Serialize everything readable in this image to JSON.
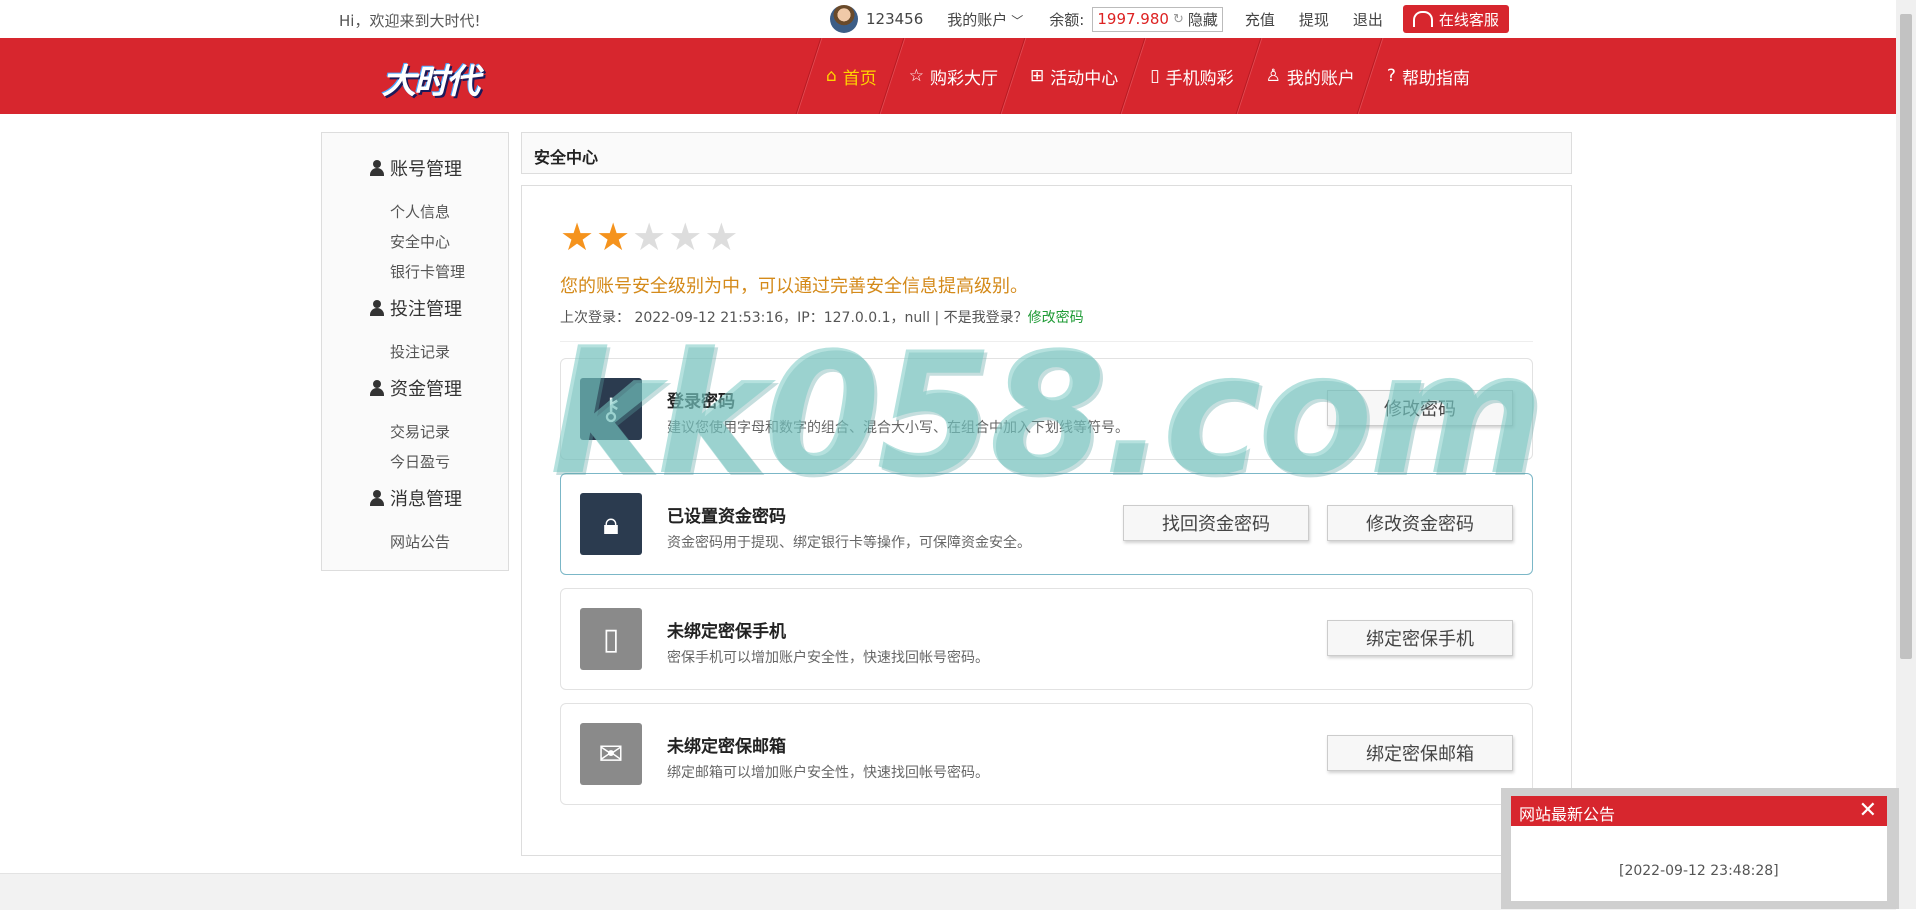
{
  "topbar": {
    "welcome": "Hi，欢迎来到大时代!",
    "username": "123456",
    "my_account": "我的账户",
    "balance_label": "余额:",
    "balance_value": "1997.980",
    "hide": "隐藏",
    "recharge": "充值",
    "withdraw": "提现",
    "logout": "退出",
    "online_service": "在线客服"
  },
  "nav": {
    "logo_text": "大时代",
    "items": [
      {
        "label": "首页",
        "icon": "home-icon"
      },
      {
        "label": "购彩大厅",
        "icon": "star-outline-icon"
      },
      {
        "label": "活动中心",
        "icon": "gift-icon"
      },
      {
        "label": "手机购彩",
        "icon": "phone-icon"
      },
      {
        "label": "我的账户",
        "icon": "user-icon"
      },
      {
        "label": "帮助指南",
        "icon": "help-icon"
      }
    ]
  },
  "sidebar": {
    "groups": [
      {
        "title": "账号管理",
        "links": [
          "个人信息",
          "安全中心",
          "银行卡管理"
        ]
      },
      {
        "title": "投注管理",
        "links": [
          "投注记录"
        ]
      },
      {
        "title": "资金管理",
        "links": [
          "交易记录",
          "今日盈亏"
        ]
      },
      {
        "title": "消息管理",
        "links": [
          "网站公告"
        ]
      }
    ]
  },
  "main": {
    "title": "安全中心",
    "rating": 2,
    "rating_max": 5,
    "level_text": "您的账号安全级别为中，可以通过完善安全信息提高级别。",
    "last_login_prefix": "上次登录：",
    "last_login_time": "2022-09-12 21:53:16",
    "last_login_ip": "，IP：127.0.0.1，null | 不是我登录？",
    "change_password_link": "修改密码",
    "cards": [
      {
        "title": "登录密码",
        "desc": "建议您使用字母和数字的组合、混合大小写、在组合中加入下划线等符号。",
        "buttons": [
          "修改密码"
        ],
        "icon": "key-icon"
      },
      {
        "title": "已设置资金密码",
        "desc": "资金密码用于提现、绑定银行卡等操作，可保障资金安全。",
        "buttons": [
          "找回资金密码",
          "修改资金密码"
        ],
        "icon": "lock-icon"
      },
      {
        "title": "未绑定密保手机",
        "desc": "密保手机可以增加账户安全性，快速找回帐号密码。",
        "buttons": [
          "绑定密保手机"
        ],
        "icon": "mobile-icon"
      },
      {
        "title": "未绑定密保邮箱",
        "desc": "绑定邮箱可以增加账户安全性，快速找回帐号密码。",
        "buttons": [
          "绑定密保邮箱"
        ],
        "icon": "mail-icon"
      }
    ]
  },
  "watermark": "kk058.com",
  "notice": {
    "title": "网站最新公告",
    "time": "[2022-09-12 23:48:28]"
  },
  "colors": {
    "brand_red": "#d7262e",
    "star_on": "#f5931d",
    "warn_text": "#d48a1a",
    "link_green": "#1f9b36"
  }
}
